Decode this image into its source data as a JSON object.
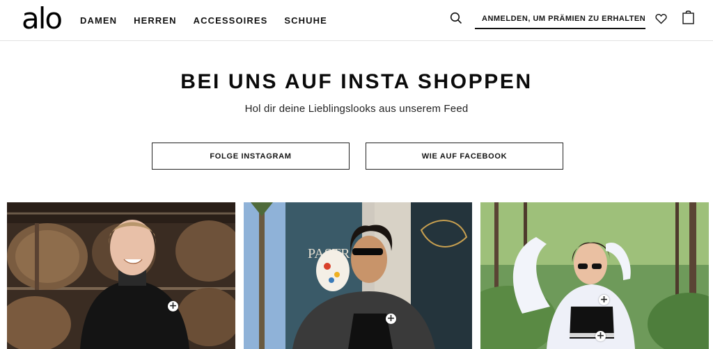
{
  "header": {
    "logo": "alo",
    "nav": [
      "DAMEN",
      "HERREN",
      "ACCESSOIRES",
      "SCHUHE"
    ],
    "account_label": "ANMELDEN, UM PRÄMIEN ZU ERHALTEN",
    "icons": [
      "search-icon",
      "user-icon",
      "heart-icon",
      "bag-icon"
    ]
  },
  "hero": {
    "title": "BEI UNS AUF INSTA SHOPPEN",
    "subtitle": "Hol dir deine Lieblingslooks aus unserem Feed",
    "buttons": [
      "FOLGE INSTAGRAM",
      "WIE AUF FACEBOOK"
    ]
  },
  "gallery": {
    "items": [
      {
        "plus": "+"
      },
      {
        "plus": "+"
      },
      {
        "plus": "+"
      }
    ]
  }
}
